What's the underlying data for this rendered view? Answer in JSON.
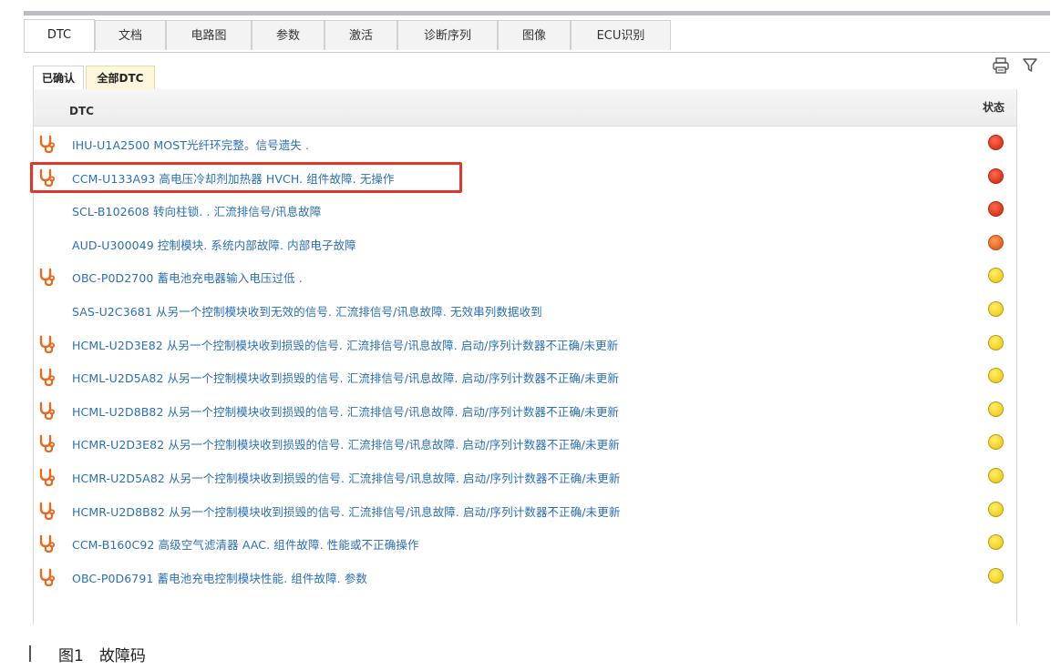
{
  "tabs": [
    {
      "label": "DTC"
    },
    {
      "label": "文档"
    },
    {
      "label": "电路图"
    },
    {
      "label": "参数"
    },
    {
      "label": "激活"
    },
    {
      "label": "诊断序列"
    },
    {
      "label": "图像"
    },
    {
      "label": "ECU识别"
    }
  ],
  "subtabs": [
    {
      "label": "已确认"
    },
    {
      "label": "全部DTC"
    }
  ],
  "table": {
    "col_dtc": "DTC",
    "col_status": "状态",
    "rows": [
      {
        "text": "IHU-U1A2500 MOST光纤环完整。信号遗失 .",
        "icon": true,
        "status": "red"
      },
      {
        "text": "CCM-U133A93 高电压冷却剂加热器 HVCH. 组件故障. 无操作",
        "icon": true,
        "status": "red"
      },
      {
        "text": "SCL-B102608 转向柱锁. . 汇流排信号/讯息故障",
        "icon": false,
        "status": "red"
      },
      {
        "text": "AUD-U300049 控制模块. 系统内部故障. 内部电子故障",
        "icon": false,
        "status": "orange"
      },
      {
        "text": "OBC-P0D2700 蓄电池充电器输入电压过低 .",
        "icon": true,
        "status": "yellow"
      },
      {
        "text": "SAS-U2C3681 从另一个控制模块收到无效的信号. 汇流排信号/讯息故障. 无效串列数据收到",
        "icon": false,
        "status": "yellow"
      },
      {
        "text": "HCML-U2D3E82 从另一个控制模块收到损毁的信号. 汇流排信号/讯息故障. 启动/序列计数器不正确/未更新",
        "icon": true,
        "status": "yellow"
      },
      {
        "text": "HCML-U2D5A82 从另一个控制模块收到损毁的信号. 汇流排信号/讯息故障. 启动/序列计数器不正确/未更新",
        "icon": true,
        "status": "yellow"
      },
      {
        "text": "HCML-U2D8B82 从另一个控制模块收到损毁的信号. 汇流排信号/讯息故障. 启动/序列计数器不正确/未更新",
        "icon": true,
        "status": "yellow"
      },
      {
        "text": "HCMR-U2D3E82 从另一个控制模块收到损毁的信号. 汇流排信号/讯息故障. 启动/序列计数器不正确/未更新",
        "icon": true,
        "status": "yellow"
      },
      {
        "text": "HCMR-U2D5A82 从另一个控制模块收到损毁的信号. 汇流排信号/讯息故障. 启动/序列计数器不正确/未更新",
        "icon": true,
        "status": "yellow"
      },
      {
        "text": "HCMR-U2D8B82 从另一个控制模块收到损毁的信号. 汇流排信号/讯息故障. 启动/序列计数器不正确/未更新",
        "icon": true,
        "status": "yellow"
      },
      {
        "text": "CCM-B160C92 高级空气滤清器 AAC. 组件故障. 性能或不正确操作",
        "icon": true,
        "status": "yellow"
      },
      {
        "text": "OBC-P0D6791 蓄电池充电控制模块性能. 组件故障. 参数",
        "icon": true,
        "status": "yellow"
      }
    ]
  },
  "toolbar": {
    "print_icon": "printer-icon",
    "filter_icon": "filter-icon"
  },
  "status_colors": {
    "red": "#d9361c",
    "orange": "#e1651f",
    "yellow": "#f2cf22"
  },
  "caption": {
    "label": "图1　故障码"
  }
}
